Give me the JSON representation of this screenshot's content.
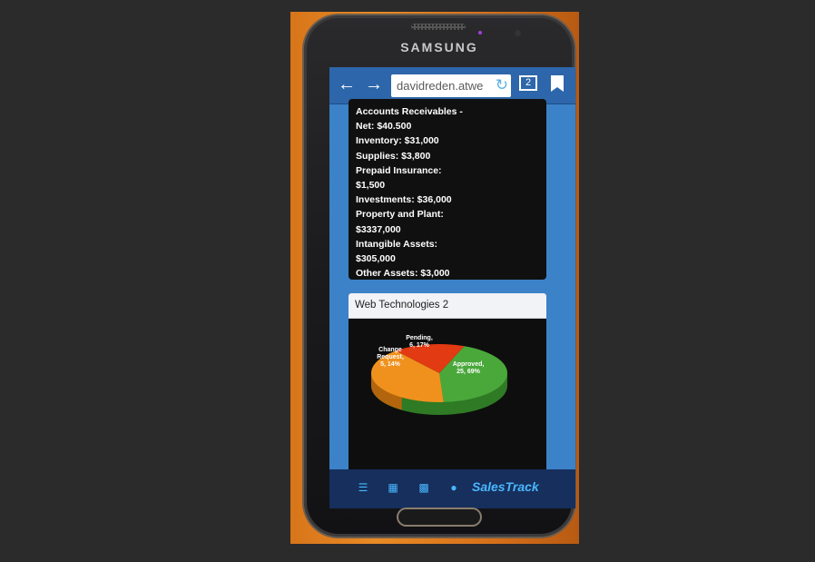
{
  "phone": {
    "brand": "SAMSUNG"
  },
  "browser": {
    "back_icon": "arrow-left-icon",
    "forward_icon": "arrow-right-icon",
    "url": "davidreden.atwe",
    "tab_count": "2"
  },
  "assets": {
    "lines": [
      "Accounts Receivables -",
      "Net: $40.500",
      "Inventory: $31,000",
      "Supplies: $3,800",
      "Prepaid Insurance:",
      "$1,500",
      "Investments: $36,000",
      "Property and Plant:",
      "$3337,000",
      "Intangible Assets:",
      "$305,000",
      "Other Assets: $3,000"
    ]
  },
  "chart": {
    "title": "Web Technologies 2",
    "colors": {
      "approved": "#4aa83a",
      "pending": "#e23a12",
      "change": "#f0911e"
    }
  },
  "chart_data": {
    "type": "pie",
    "title": "Web Technologies 2",
    "slices": [
      {
        "label": "Approved",
        "value": 25,
        "percent": 69,
        "text1": "Approved,",
        "text2": "25, 69%"
      },
      {
        "label": "Pending",
        "value": 6,
        "percent": 17,
        "text1": "Pending,",
        "text2": "6, 17%"
      },
      {
        "label": "Change Request",
        "value": 5,
        "percent": 14,
        "text1": "Change",
        "text2": "Request,",
        "text3": "5, 14%"
      }
    ]
  },
  "bottom_nav": {
    "items": [
      "menu-icon",
      "grid-icon",
      "table-icon",
      "user-icon"
    ],
    "logo": "SalesTrack"
  }
}
